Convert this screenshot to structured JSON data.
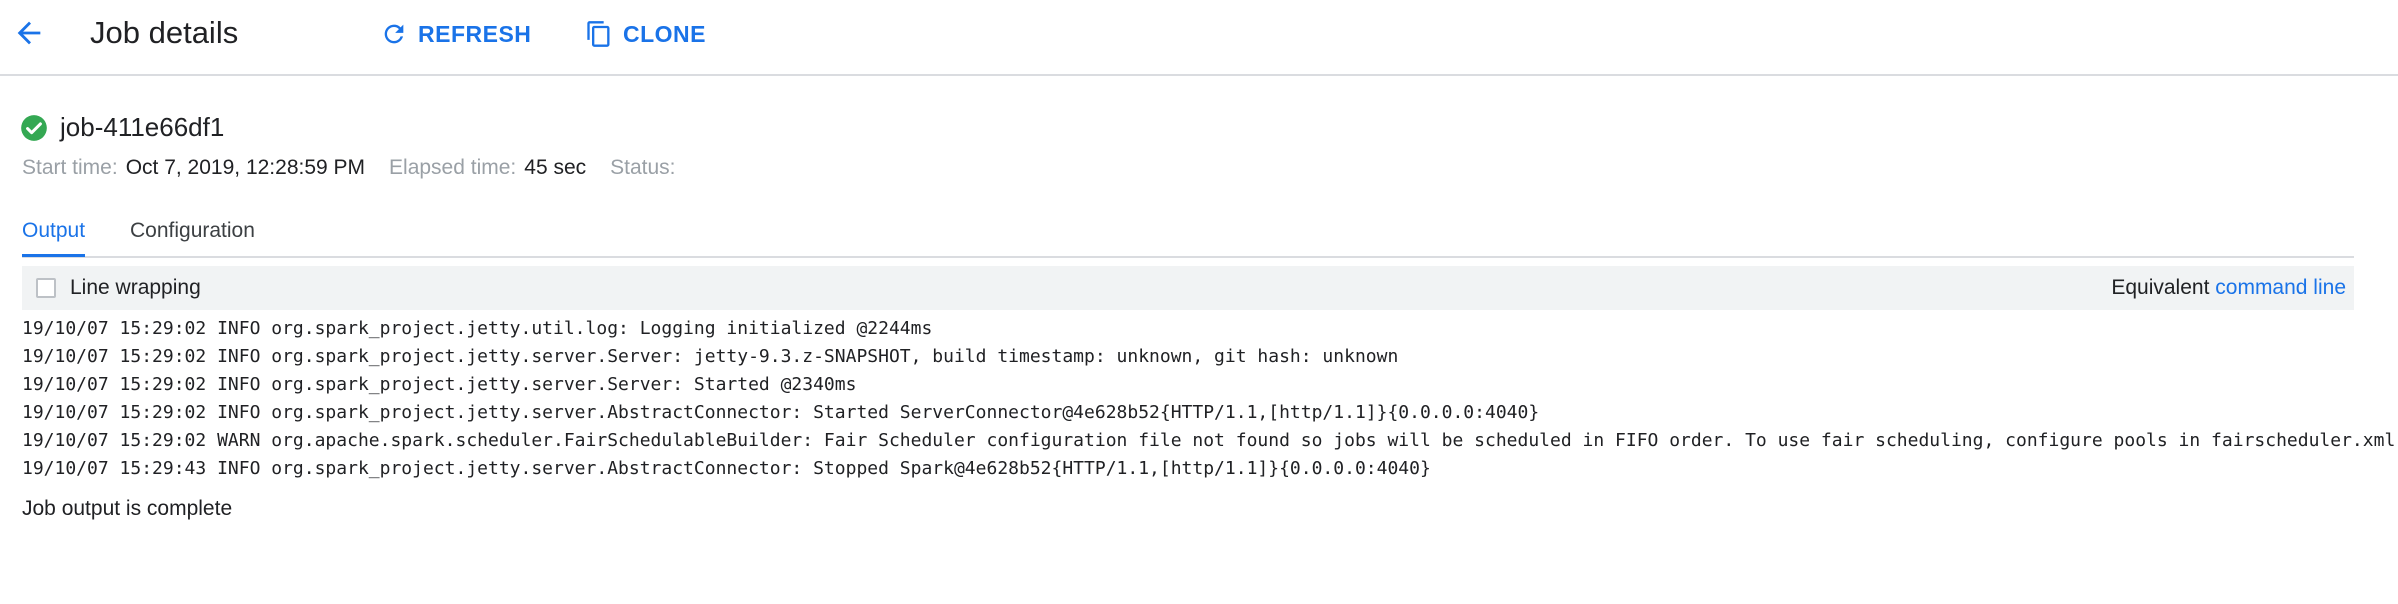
{
  "header": {
    "title": "Job details",
    "refresh_label": "REFRESH",
    "clone_label": "CLONE",
    "back_icon": "arrow-back-icon",
    "refresh_icon": "refresh-icon",
    "clone_icon": "copy-icon"
  },
  "job": {
    "id": "job-411e66df1",
    "status_icon": "check-circle-icon",
    "status_color": "#34a853",
    "start_time_label": "Start time:",
    "start_time_value": "Oct 7, 2019, 12:28:59 PM",
    "elapsed_label": "Elapsed time:",
    "elapsed_value": "45 sec",
    "status_label": "Status:"
  },
  "tabs": [
    {
      "label": "Output",
      "active": true
    },
    {
      "label": "Configuration",
      "active": false
    }
  ],
  "toolbar": {
    "line_wrapping_label": "Line wrapping",
    "line_wrapping_checked": false,
    "equivalent_text": "Equivalent",
    "command_line_link": "command line"
  },
  "log_lines": [
    "19/10/07 15:29:02 INFO org.spark_project.jetty.util.log: Logging initialized @2244ms",
    "19/10/07 15:29:02 INFO org.spark_project.jetty.server.Server: jetty-9.3.z-SNAPSHOT, build timestamp: unknown, git hash: unknown",
    "19/10/07 15:29:02 INFO org.spark_project.jetty.server.Server: Started @2340ms",
    "19/10/07 15:29:02 INFO org.spark_project.jetty.server.AbstractConnector: Started ServerConnector@4e628b52{HTTP/1.1,[http/1.1]}{0.0.0.0:4040}",
    "19/10/07 15:29:02 WARN org.apache.spark.scheduler.FairSchedulableBuilder: Fair Scheduler configuration file not found so jobs will be scheduled in FIFO order. To use fair scheduling, configure pools in fairscheduler.xml o",
    "19/10/07 15:29:43 INFO org.spark_project.jetty.server.AbstractConnector: Stopped Spark@4e628b52{HTTP/1.1,[http/1.1]}{0.0.0.0:4040}"
  ],
  "completion_message": "Job output is complete",
  "colors": {
    "accent": "#1a73e8",
    "success": "#34a853"
  }
}
